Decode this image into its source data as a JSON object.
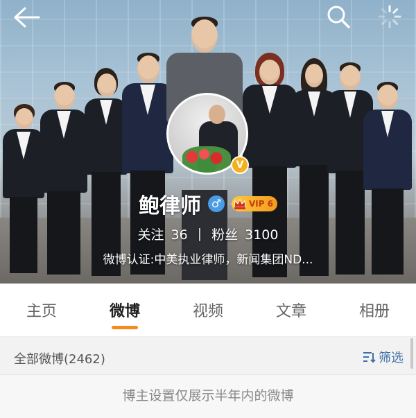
{
  "profile": {
    "name": "鲍律师",
    "vip_level": "VIP 6",
    "verified_mark": "V",
    "gender_symbol": "♂",
    "follow_label": "关注",
    "follow_count": "36",
    "separator": "|",
    "fans_label": "粉丝",
    "fans_count": "3100",
    "verification": "微博认证:中美执业律师，新闻集团ND..."
  },
  "tabs": [
    {
      "label": "主页",
      "active": false
    },
    {
      "label": "微博",
      "active": true
    },
    {
      "label": "视频",
      "active": false
    },
    {
      "label": "文章",
      "active": false
    },
    {
      "label": "相册",
      "active": false
    }
  ],
  "feed": {
    "all_posts_label": "全部微博(2462)",
    "filter_label": "筛选",
    "notice": "博主设置仅展示半年内的微博"
  },
  "colors": {
    "accent_orange": "#f58a1f",
    "link_blue": "#3f6fa8",
    "verified_gold": "#f3b21b"
  },
  "icons": [
    "back-arrow-icon",
    "search-icon",
    "loading-spinner-icon",
    "male-gender-icon",
    "vip-crown-icon",
    "filter-icon"
  ]
}
